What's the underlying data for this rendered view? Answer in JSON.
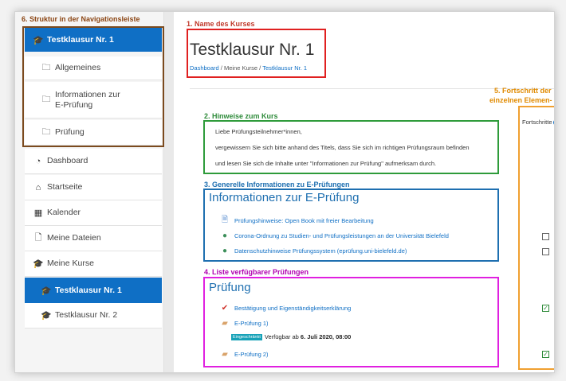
{
  "annotations": {
    "nav_structure": "6. Struktur in der Navigationsleiste",
    "course_name": "1. Name des Kurses",
    "progress": [
      "5. Fortschritt der",
      "einzelnen Elemen-"
    ],
    "hints": "2. Hinweise zum Kurs",
    "general_info": "3. Generelle Informationen zu E-Prüfungen",
    "exam_list": "4. Liste verfügbarer Prüfungen"
  },
  "sidebar": {
    "items": [
      {
        "label": "Testklausur Nr. 1",
        "icon": "graduation-cap-icon",
        "active": true
      },
      {
        "label": "Allgemeines",
        "icon": "folder-icon"
      },
      {
        "label": "Informationen zur\nE-Prüfung",
        "icon": "folder-icon"
      },
      {
        "label": "Prüfung",
        "icon": "folder-icon"
      },
      {
        "label": "Dashboard",
        "icon": "tachometer-icon"
      },
      {
        "label": "Startseite",
        "icon": "home-icon"
      },
      {
        "label": "Kalender",
        "icon": "calendar-icon"
      },
      {
        "label": "Meine Dateien",
        "icon": "file-icon"
      },
      {
        "label": "Meine Kurse",
        "icon": "graduation-cap-icon"
      },
      {
        "label": "Testklausur Nr. 1",
        "icon": "graduation-cap-icon",
        "active": true
      },
      {
        "label": "Testklausur Nr. 2",
        "icon": "graduation-cap-icon"
      }
    ]
  },
  "header": {
    "title": "Testklausur Nr. 1",
    "breadcrumb": [
      "Dashboard",
      "Meine Kurse",
      "Testklausur Nr. 1"
    ]
  },
  "progress_header": "Fortschritte",
  "hints": [
    "Liebe Prüfungsteilnehmer*innen,",
    "vergewissern Sie sich bitte anhand des Titels, dass Sie sich im richtigen Prüfungsraum befinden",
    "und lesen Sie sich die Inhalte unter \"Informationen zur Prüfung\" aufmerksam durch."
  ],
  "info_section": {
    "title": "Informationen zur E-Prüfung",
    "activities": [
      {
        "label": "Prüfungshinweise: Open Book mit freier Bearbeitung",
        "icon": "page-icon"
      },
      {
        "label": "Corona-Ordnung zu Studien- und Prüfungsleistungen an der Universität Bielefeld",
        "icon": "url-globe-icon"
      },
      {
        "label": "Datenschutzhinweise Prüfungssystem (eprüfung.uni-bielefeld.de)",
        "icon": "url-globe-icon"
      }
    ]
  },
  "exam_section": {
    "title": "Prüfung",
    "activities": [
      {
        "label": "Bestätigung und Eigenständigkeitserklärung",
        "icon": "checkmark-icon"
      },
      {
        "label": "E-Prüfung 1)",
        "icon": "quiz-icon"
      },
      {
        "label": "E-Prüfung 2)",
        "icon": "quiz-icon"
      }
    ],
    "restriction_badge": "Eingeschränkt",
    "restriction_text": "Verfügbar ab",
    "restriction_date": "6. Juli 2020, 08:00"
  },
  "colors": {
    "primary": "#0f6fc5",
    "red_box": "#e02020",
    "green_box": "#2e9b3a",
    "blue_box": "#1e6fb0",
    "magenta_box": "#e020e0",
    "orange_box": "#f0a030",
    "brown_box": "#7b4a1e"
  }
}
